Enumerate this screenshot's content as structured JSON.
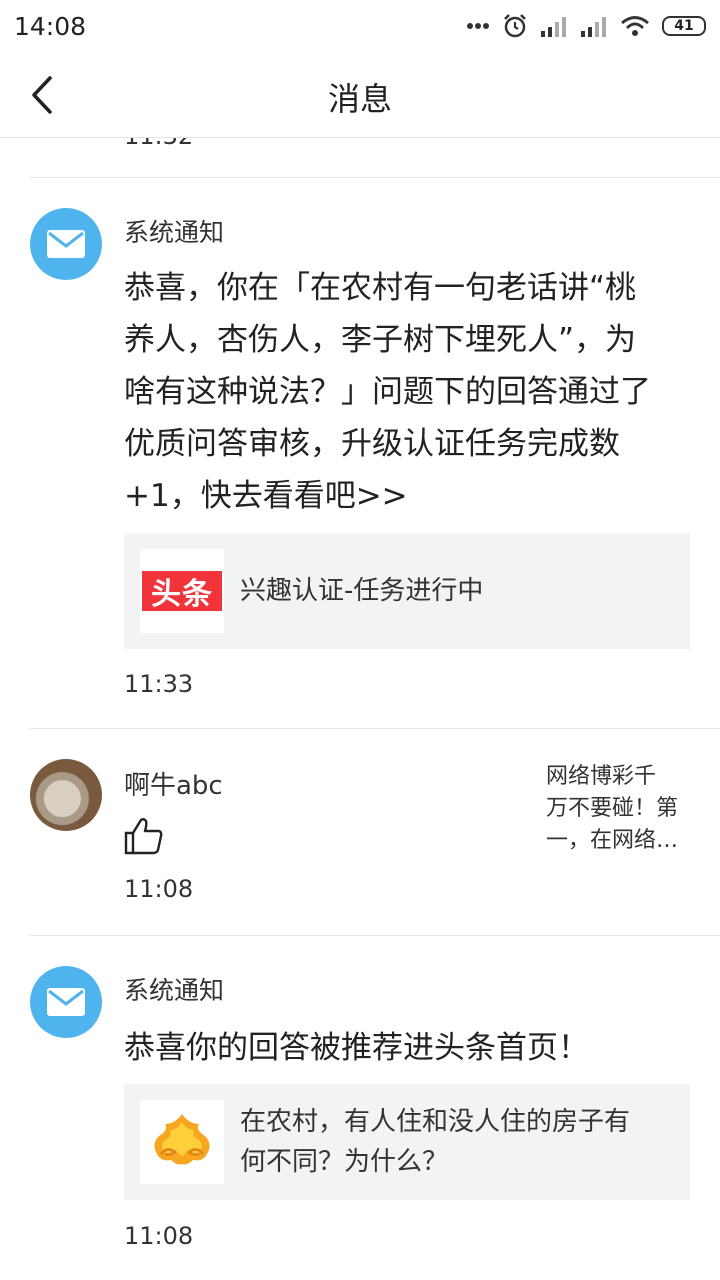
{
  "status_bar": {
    "time": "14:08",
    "battery": "41",
    "icons": [
      "more-dots-icon",
      "alarm-icon",
      "signal-icon",
      "signal-icon",
      "wifi-icon",
      "battery-icon"
    ]
  },
  "header": {
    "title": "消息",
    "back_icon": "chevron-left-icon"
  },
  "list": {
    "cut_off_time": "11:32",
    "items": [
      {
        "sender": "系统通知",
        "avatar": "mail-icon",
        "avatar_color": "#4fb4ee",
        "message": "恭喜，你在「在农村有一句老话讲“桃养人，杏伤人，李子树下埋死人”，为啥有这种说法？」问题下的回答通过了优质问答审核，升级认证任务完成数+1，快去看看吧>>",
        "message_lines": [
          "恭喜，你在「在农村有一句老话讲“桃",
          "养人，杏伤人，李子树下埋死人”，为",
          "啥有这种说法？」问题下的回答通过了",
          "优质问答审核，升级认证任务完成数",
          "+1，快去看看吧>>"
        ],
        "card": {
          "logo_text": "头条",
          "logo_color": "#f0343a",
          "text": "兴趣认证-任务进行中"
        },
        "time": "11:33"
      },
      {
        "sender": "啊牛abc",
        "avatar": "user-photo",
        "icon": "thumbs-up-icon",
        "preview": "网络博彩千万不要碰！第一，在网络…",
        "preview_lines": [
          "网络博彩千",
          "万不要碰！第",
          "一，在网络…"
        ],
        "time": "11:08"
      },
      {
        "sender": "系统通知",
        "avatar": "mail-icon",
        "message": "恭喜你的回答被推荐进头条首页！",
        "card": {
          "logo": "golden-cloud-icon",
          "text_lines": [
            "在农村，有人住和没人住的房子有",
            "何不同？为什么？"
          ]
        },
        "time": "11:08"
      }
    ]
  }
}
